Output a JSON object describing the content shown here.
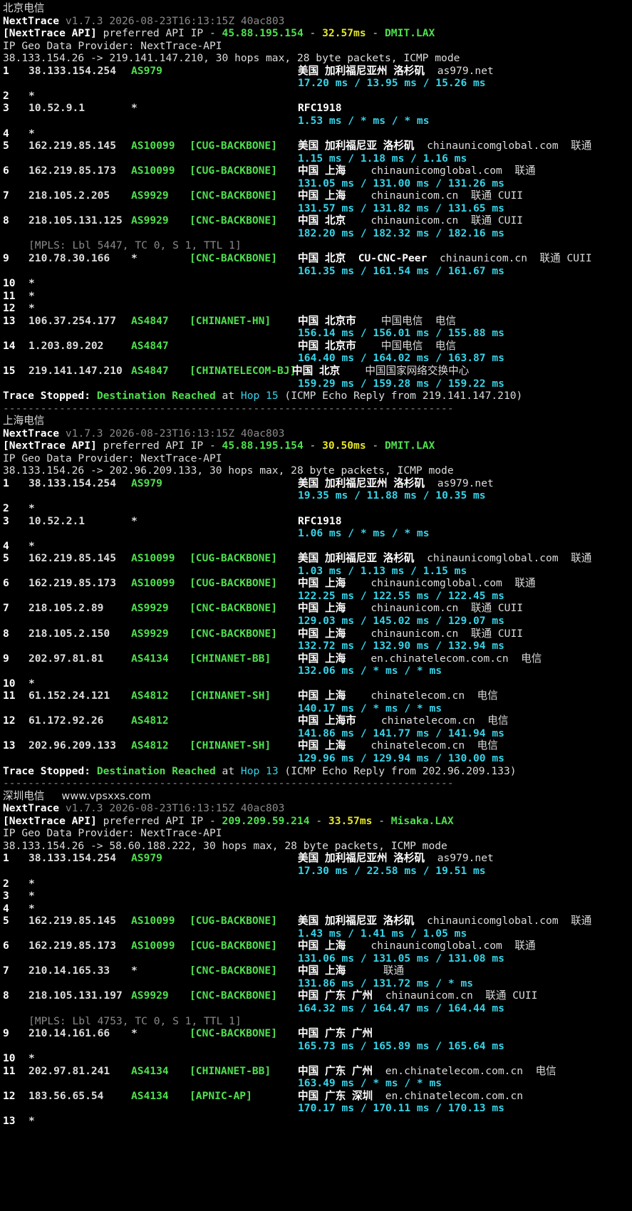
{
  "sections": [
    {
      "title": "北京电信",
      "watermark": "",
      "version": "v1.7.3 2026-08-23T16:13:15Z 40ac803",
      "api_ip": "45.88.195.154",
      "api_ms": "32.57ms",
      "api_node": "DMIT.LAX",
      "route": "38.133.154.26 -> 219.141.147.210, 30 hops max, 28 byte packets, ICMP mode",
      "hops": [
        {
          "n": "1",
          "ip": "38.133.154.254",
          "asn": "AS979",
          "tag": "",
          "geo": "美国 加利福尼亚州 洛杉矶",
          "extra": "as979.net",
          "lat": "17.20 ms / 13.95 ms / 15.26 ms"
        },
        {
          "n": "2",
          "star": true
        },
        {
          "n": "3",
          "ip": "10.52.9.1",
          "asn": "*",
          "tag": "",
          "geo": "RFC1918",
          "extra": "",
          "lat": "1.53 ms / * ms / * ms"
        },
        {
          "n": "4",
          "star": true
        },
        {
          "n": "5",
          "ip": "162.219.85.145",
          "asn": "AS10099",
          "tag": "[CUG-BACKBONE]",
          "geo": "美国 加利福尼亚 洛杉矶",
          "extra": "chinaunicomglobal.com  联通",
          "lat": "1.15 ms / 1.18 ms / 1.16 ms"
        },
        {
          "n": "6",
          "ip": "162.219.85.173",
          "asn": "AS10099",
          "tag": "[CUG-BACKBONE]",
          "geo": "中国 上海",
          "extra": "  chinaunicomglobal.com  联通",
          "lat": "131.05 ms / 131.00 ms / 131.26 ms"
        },
        {
          "n": "7",
          "ip": "218.105.2.205",
          "asn": "AS9929",
          "tag": "[CNC-BACKBONE]",
          "geo": "中国 上海",
          "extra": "  chinaunicom.cn  联通 CUII",
          "lat": "131.57 ms / 131.82 ms / 131.65 ms"
        },
        {
          "n": "8",
          "ip": "218.105.131.125",
          "asn": "AS9929",
          "tag": "[CNC-BACKBONE]",
          "geo": "中国 北京",
          "extra": "  chinaunicom.cn  联通 CUII",
          "lat": "182.20 ms / 182.32 ms / 182.16 ms"
        },
        {
          "mpls": "[MPLS: Lbl 5447, TC 0, S 1, TTL 1]"
        },
        {
          "n": "9",
          "ip": "210.78.30.166",
          "asn": "*",
          "tag": "[CNC-BACKBONE]",
          "geo": "中国 北京  CU-CNC-Peer",
          "extra": "chinaunicom.cn  联通 CUII",
          "lat": "161.35 ms / 161.54 ms / 161.67 ms"
        },
        {
          "n": "10",
          "star": true
        },
        {
          "n": "11",
          "star": true
        },
        {
          "n": "12",
          "star": true
        },
        {
          "n": "13",
          "ip": "106.37.254.177",
          "asn": "AS4847",
          "tag": "[CHINANET-HN]",
          "geo": "中国 北京市",
          "extra": "  中国电信  电信",
          "lat": "156.14 ms / 156.01 ms / 155.88 ms"
        },
        {
          "n": "14",
          "ip": "1.203.89.202",
          "asn": "AS4847",
          "tag": "",
          "geo": "中国 北京市",
          "extra": "  中国电信  电信",
          "lat": "164.40 ms / 164.02 ms / 163.87 ms"
        },
        {
          "n": "15",
          "ip": "219.141.147.210",
          "asn": "AS4847",
          "tag": "[CHINATELECOM-BJ]",
          "geo": "中国 北京",
          "extra": "  中国国家网络交换中心",
          "lat": "159.29 ms / 159.28 ms / 159.22 ms",
          "geoShift": true
        }
      ],
      "stop_hop": "Hop 15",
      "stop_from": "(ICMP Echo Reply from 219.141.147.210)"
    },
    {
      "title": "上海电信",
      "watermark": "",
      "version": "v1.7.3 2026-08-23T16:13:15Z 40ac803",
      "api_ip": "45.88.195.154",
      "api_ms": "30.50ms",
      "api_node": "DMIT.LAX",
      "route": "38.133.154.26 -> 202.96.209.133, 30 hops max, 28 byte packets, ICMP mode",
      "hops": [
        {
          "n": "1",
          "ip": "38.133.154.254",
          "asn": "AS979",
          "tag": "",
          "geo": "美国 加利福尼亚州 洛杉矶",
          "extra": "as979.net",
          "lat": "19.35 ms / 11.88 ms / 10.35 ms"
        },
        {
          "n": "2",
          "star": true
        },
        {
          "n": "3",
          "ip": "10.52.2.1",
          "asn": "*",
          "tag": "",
          "geo": "RFC1918",
          "extra": "",
          "lat": "1.06 ms / * ms / * ms"
        },
        {
          "n": "4",
          "star": true
        },
        {
          "n": "5",
          "ip": "162.219.85.145",
          "asn": "AS10099",
          "tag": "[CUG-BACKBONE]",
          "geo": "美国 加利福尼亚 洛杉矶",
          "extra": "chinaunicomglobal.com  联通",
          "lat": "1.03 ms / 1.13 ms / 1.15 ms"
        },
        {
          "n": "6",
          "ip": "162.219.85.173",
          "asn": "AS10099",
          "tag": "[CUG-BACKBONE]",
          "geo": "中国 上海",
          "extra": "  chinaunicomglobal.com  联通",
          "lat": "122.25 ms / 122.55 ms / 122.45 ms"
        },
        {
          "n": "7",
          "ip": "218.105.2.89",
          "asn": "AS9929",
          "tag": "[CNC-BACKBONE]",
          "geo": "中国 上海",
          "extra": "  chinaunicom.cn  联通 CUII",
          "lat": "129.03 ms / 145.02 ms / 129.07 ms"
        },
        {
          "n": "8",
          "ip": "218.105.2.150",
          "asn": "AS9929",
          "tag": "[CNC-BACKBONE]",
          "geo": "中国 上海",
          "extra": "  chinaunicom.cn  联通 CUII",
          "lat": "132.72 ms / 132.90 ms / 132.94 ms"
        },
        {
          "n": "9",
          "ip": "202.97.81.81",
          "asn": "AS4134",
          "tag": "[CHINANET-BB]",
          "geo": "中国 上海",
          "extra": "  en.chinatelecom.com.cn  电信",
          "lat": "132.06 ms / * ms / * ms"
        },
        {
          "n": "10",
          "star": true
        },
        {
          "n": "11",
          "ip": "61.152.24.121",
          "asn": "AS4812",
          "tag": "[CHINANET-SH]",
          "geo": "中国 上海",
          "extra": "  chinatelecom.cn  电信",
          "lat": "140.17 ms / * ms / * ms"
        },
        {
          "n": "12",
          "ip": "61.172.92.26",
          "asn": "AS4812",
          "tag": "",
          "geo": "中国 上海市",
          "extra": "  chinatelecom.cn  电信",
          "lat": "141.86 ms / 141.77 ms / 141.94 ms"
        },
        {
          "n": "13",
          "ip": "202.96.209.133",
          "asn": "AS4812",
          "tag": "[CHINANET-SH]",
          "geo": "中国 上海",
          "extra": "  chinatelecom.cn  电信",
          "lat": "129.96 ms / 129.94 ms / 130.00 ms"
        }
      ],
      "stop_hop": "Hop 13",
      "stop_from": "(ICMP Echo Reply from 202.96.209.133)"
    },
    {
      "title": "深圳电信",
      "watermark": "www.vpsxxs.com",
      "version": "v1.7.3 2026-08-23T16:13:15Z 40ac803",
      "api_ip": "209.209.59.214",
      "api_ms": "33.57ms",
      "api_node": "Misaka.LAX",
      "route": "38.133.154.26 -> 58.60.188.222, 30 hops max, 28 byte packets, ICMP mode",
      "hops": [
        {
          "n": "1",
          "ip": "38.133.154.254",
          "asn": "AS979",
          "tag": "",
          "geo": "美国 加利福尼亚州 洛杉矶",
          "extra": "as979.net",
          "lat": "17.30 ms / 22.58 ms / 19.51 ms"
        },
        {
          "n": "2",
          "star": true
        },
        {
          "n": "3",
          "star": true
        },
        {
          "n": "4",
          "star": true
        },
        {
          "n": "5",
          "ip": "162.219.85.145",
          "asn": "AS10099",
          "tag": "[CUG-BACKBONE]",
          "geo": "美国 加利福尼亚 洛杉矶",
          "extra": "chinaunicomglobal.com  联通",
          "lat": "1.43 ms / 1.41 ms / 1.05 ms"
        },
        {
          "n": "6",
          "ip": "162.219.85.173",
          "asn": "AS10099",
          "tag": "[CUG-BACKBONE]",
          "geo": "中国 上海",
          "extra": "  chinaunicomglobal.com  联通",
          "lat": "131.06 ms / 131.05 ms / 131.08 ms"
        },
        {
          "n": "7",
          "ip": "210.14.165.33",
          "asn": "*",
          "tag": "[CNC-BACKBONE]",
          "geo": "中国 上海",
          "extra": "    联通",
          "lat": "131.86 ms / 131.72 ms / * ms"
        },
        {
          "n": "8",
          "ip": "218.105.131.197",
          "asn": "AS9929",
          "tag": "[CNC-BACKBONE]",
          "geo": "中国 广东 广州",
          "extra": "chinaunicom.cn  联通 CUII",
          "lat": "164.32 ms / 164.47 ms / 164.44 ms"
        },
        {
          "mpls": "[MPLS: Lbl 4753, TC 0, S 1, TTL 1]"
        },
        {
          "n": "9",
          "ip": "210.14.161.66",
          "asn": "*",
          "tag": "[CNC-BACKBONE]",
          "geo": "中国 广东 广州",
          "extra": "",
          "lat": "165.73 ms / 165.89 ms / 165.64 ms"
        },
        {
          "n": "10",
          "star": true
        },
        {
          "n": "11",
          "ip": "202.97.81.241",
          "asn": "AS4134",
          "tag": "[CHINANET-BB]",
          "geo": "中国 广东 广州",
          "extra": "en.chinatelecom.com.cn  电信",
          "lat": "163.49 ms / * ms / * ms"
        },
        {
          "n": "12",
          "ip": "183.56.65.54",
          "asn": "AS4134",
          "tag": "[APNIC-AP]",
          "geo": "中国 广东 深圳",
          "extra": "en.chinatelecom.com.cn",
          "lat": "170.17 ms / 170.11 ms / 170.13 ms"
        },
        {
          "n": "13",
          "star": true
        }
      ]
    }
  ],
  "labels": {
    "tool": "NextTrace",
    "api_prefix": "[NextTrace API]",
    "api_text": " preferred API IP - ",
    "geo_provider": "IP Geo Data Provider: NextTrace-API",
    "stop_label": "Trace Stopped:",
    "stop_reason": "Destination Reached",
    "stop_at": " at ",
    "separator": "------------------------------------------------------------------------"
  },
  "colors": {
    "background": "#000000",
    "text": "#dcdcdc",
    "green": "#4ee04e",
    "yellow": "#e5e52a",
    "cyan": "#37d3e8",
    "dim": "#8a8a8a"
  }
}
